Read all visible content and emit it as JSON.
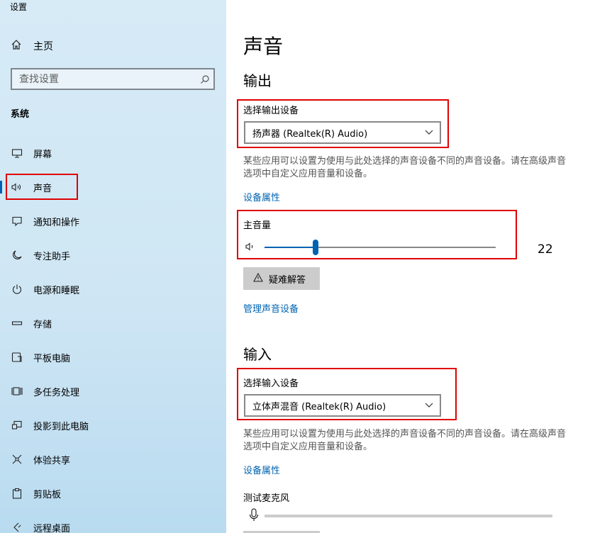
{
  "window": {
    "title": "设置"
  },
  "sidebar": {
    "home_label": "主页",
    "search_placeholder": "查找设置",
    "section_label": "系统",
    "items": [
      {
        "label": "屏幕",
        "icon": "monitor-icon"
      },
      {
        "label": "声音",
        "icon": "speaker-icon",
        "active": true
      },
      {
        "label": "通知和操作",
        "icon": "notification-icon"
      },
      {
        "label": "专注助手",
        "icon": "moon-icon"
      },
      {
        "label": "电源和睡眠",
        "icon": "power-icon"
      },
      {
        "label": "存储",
        "icon": "storage-icon"
      },
      {
        "label": "平板电脑",
        "icon": "tablet-icon"
      },
      {
        "label": "多任务处理",
        "icon": "multitask-icon"
      },
      {
        "label": "投影到此电脑",
        "icon": "project-icon"
      },
      {
        "label": "体验共享",
        "icon": "share-icon"
      },
      {
        "label": "剪贴板",
        "icon": "clipboard-icon"
      },
      {
        "label": "远程桌面",
        "icon": "remote-icon"
      }
    ]
  },
  "main": {
    "title": "声音",
    "output": {
      "heading": "输出",
      "device_label": "选择输出设备",
      "device_value": "扬声器 (Realtek(R) Audio)",
      "note": "某些应用可以设置为使用与此处选择的声音设备不同的声音设备。请在高级声音选项中自定义应用音量和设备。",
      "properties_link": "设备属性",
      "volume_label": "主音量",
      "volume_value": "22",
      "volume_fraction": 0.22,
      "troubleshoot_label": "疑难解答",
      "manage_link": "管理声音设备"
    },
    "input": {
      "heading": "输入",
      "device_label": "选择输入设备",
      "device_value": "立体声混音 (Realtek(R) Audio)",
      "note": "某些应用可以设置为使用与此处选择的声音设备不同的声音设备。请在高级声音选项中自定义应用音量和设备。",
      "properties_link": "设备属性",
      "mic_test_label": "测试麦克风"
    }
  },
  "colors": {
    "accent": "#0063b1",
    "highlight": "#e00000"
  }
}
